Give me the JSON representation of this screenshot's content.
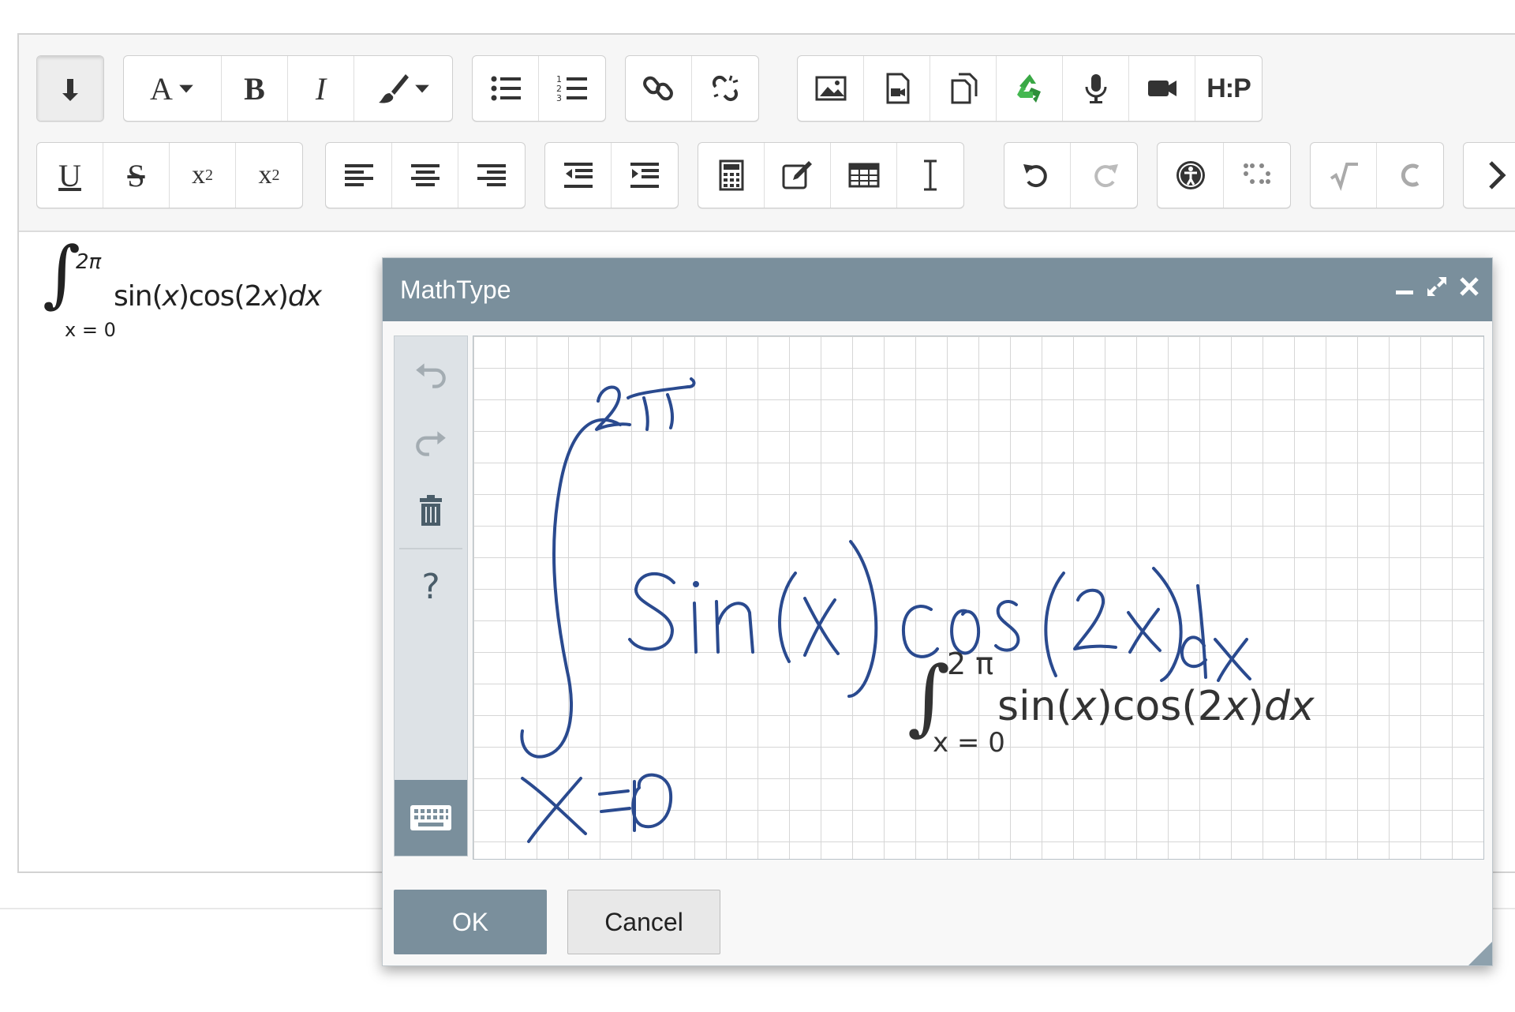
{
  "toolbar": {
    "row1": {
      "font_letter": "A",
      "bold": "B",
      "italic": "I",
      "h5p": "H:P"
    },
    "row2": {
      "underline": "U",
      "strikethrough": "S",
      "subscript_base": "x",
      "subscript_sub": "2",
      "superscript_base": "x",
      "superscript_sup": "2"
    }
  },
  "document": {
    "formula": {
      "upper": "2π",
      "lower": "x = 0",
      "body_a": "sin(",
      "x1": "x",
      "body_b": ")cos(2",
      "x2": "x",
      "body_c": ")",
      "d": "d",
      "x3": "x"
    }
  },
  "dialog": {
    "title": "MathType",
    "ok_label": "OK",
    "cancel_label": "Cancel",
    "help_label": "?",
    "recognized": {
      "upper": "2 π",
      "lower": "x = 0",
      "body_a": "sin(",
      "x1": "x",
      "body_b": ")cos(2",
      "x2": "x",
      "body_c": ")",
      "d": "d",
      "x3": "x"
    }
  },
  "colors": {
    "dialog_header": "#7a8f9c",
    "ink": "#2a4a8f",
    "toolbar_bg": "#f6f6f6",
    "recycle_green": "#3aa845"
  }
}
